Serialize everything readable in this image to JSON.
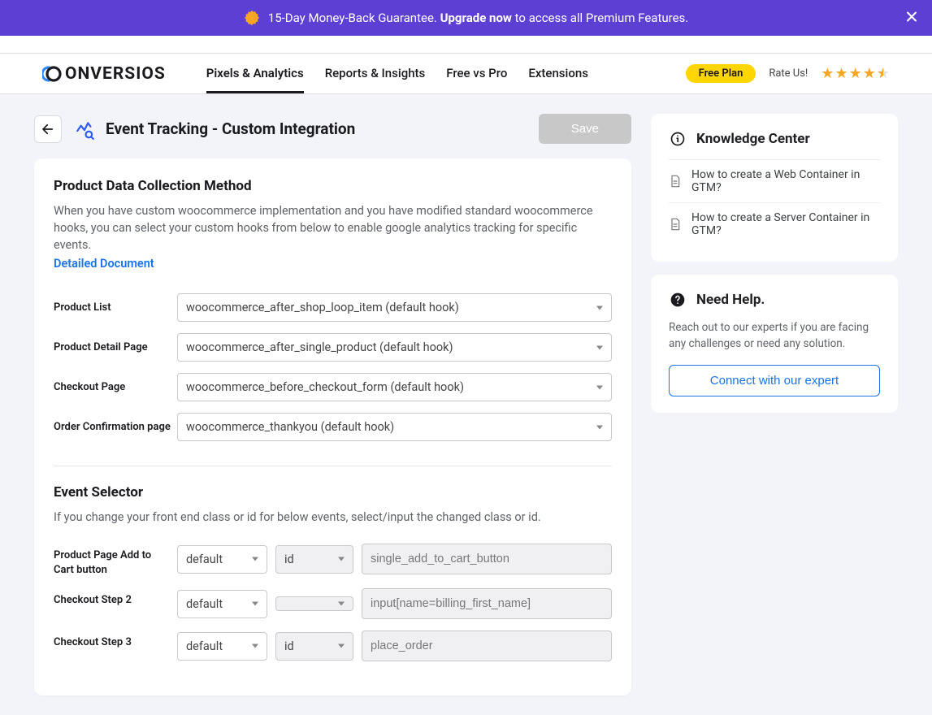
{
  "promo": {
    "text_prefix": "15-Day Money-Back Guarantee. ",
    "text_bold": "Upgrade now",
    "text_suffix": " to access all Premium Features."
  },
  "nav": {
    "logo_prefix": "C",
    "logo_rest": "ONVERSIOS",
    "tabs": [
      {
        "label": "Pixels & Analytics",
        "active": true
      },
      {
        "label": "Reports & Insights",
        "active": false
      },
      {
        "label": "Free vs Pro",
        "active": false
      },
      {
        "label": "Extensions",
        "active": false
      }
    ],
    "plan": "Free Plan",
    "rate_label": "Rate Us!"
  },
  "header": {
    "title": "Event Tracking - Custom Integration",
    "save": "Save"
  },
  "pdc": {
    "title": "Product Data Collection Method",
    "desc": "When you have custom woocommerce implementation and you have modified standard woocommerce hooks, you can select your custom hooks from below to enable google analytics tracking for specific events.",
    "link": "Detailed Document",
    "rows": [
      {
        "label": "Product List",
        "value": "woocommerce_after_shop_loop_item (default hook)"
      },
      {
        "label": "Product Detail Page",
        "value": "woocommerce_after_single_product (default hook)"
      },
      {
        "label": "Checkout Page",
        "value": "woocommerce_before_checkout_form (default hook)"
      },
      {
        "label": "Order Confirmation page",
        "value": "woocommerce_thankyou (default hook)"
      }
    ]
  },
  "es": {
    "title": "Event Selector",
    "desc": "If you change your front end class or id for below events, select/input the changed class or id.",
    "rows": [
      {
        "label": "Product Page Add to Cart button",
        "mode": "default",
        "type": "id",
        "value": "single_add_to_cart_button"
      },
      {
        "label": "Checkout Step 2",
        "mode": "default",
        "type": "",
        "value": "input[name=billing_first_name]"
      },
      {
        "label": "Checkout Step 3",
        "mode": "default",
        "type": "id",
        "value": "place_order"
      }
    ]
  },
  "kc": {
    "title": "Knowledge Center",
    "items": [
      "How to create a Web Container in GTM?",
      "How to create a Server Container in GTM?"
    ]
  },
  "help": {
    "title": "Need Help.",
    "desc": "Reach out to our experts if you are facing any challenges or need any solution.",
    "button": "Connect with our expert"
  }
}
